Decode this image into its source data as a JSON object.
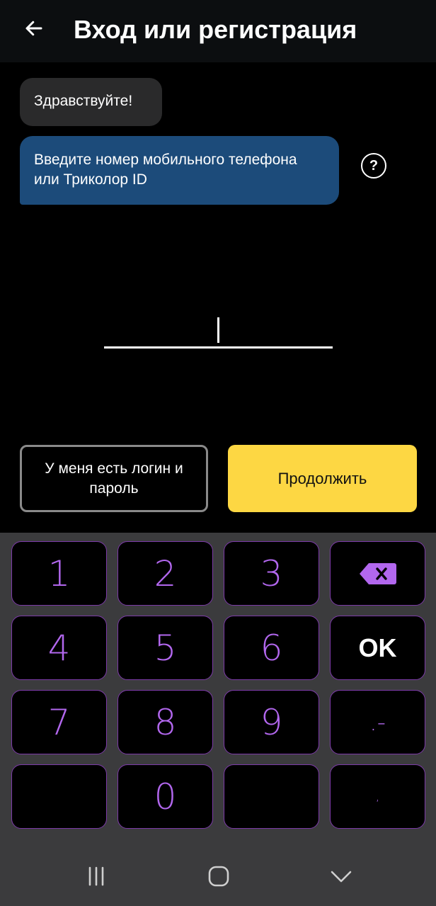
{
  "header": {
    "title": "Вход или регистрация"
  },
  "chat": {
    "greeting": "Здравствуйте!",
    "prompt": "Введите номер мобильного телефона или Триколор ID",
    "help_symbol": "?"
  },
  "input": {
    "value": ""
  },
  "actions": {
    "login_label": "У меня есть логин и пароль",
    "continue_label": "Продолжить"
  },
  "keyboard": {
    "rows": [
      [
        "1",
        "2",
        "3",
        "backspace"
      ],
      [
        "4",
        "5",
        "6",
        "OK"
      ],
      [
        "7",
        "8",
        "9",
        ".-"
      ],
      [
        "",
        "0",
        "",
        ","
      ]
    ]
  },
  "colors": {
    "app_bar": "#0c0e10",
    "prompt_bubble": "#1c4b7a",
    "greeting_bubble": "#2a2a2b",
    "continue_button": "#fdd743",
    "key_text": "#b267ee",
    "key_border": "#7c3aa8",
    "keyboard_bg": "#3b3b3d"
  },
  "icons": {
    "back": "arrow-left-icon",
    "backspace": "backspace-icon",
    "nav_recents": "recents-icon",
    "nav_home": "home-icon",
    "nav_back": "chevron-down-icon"
  }
}
